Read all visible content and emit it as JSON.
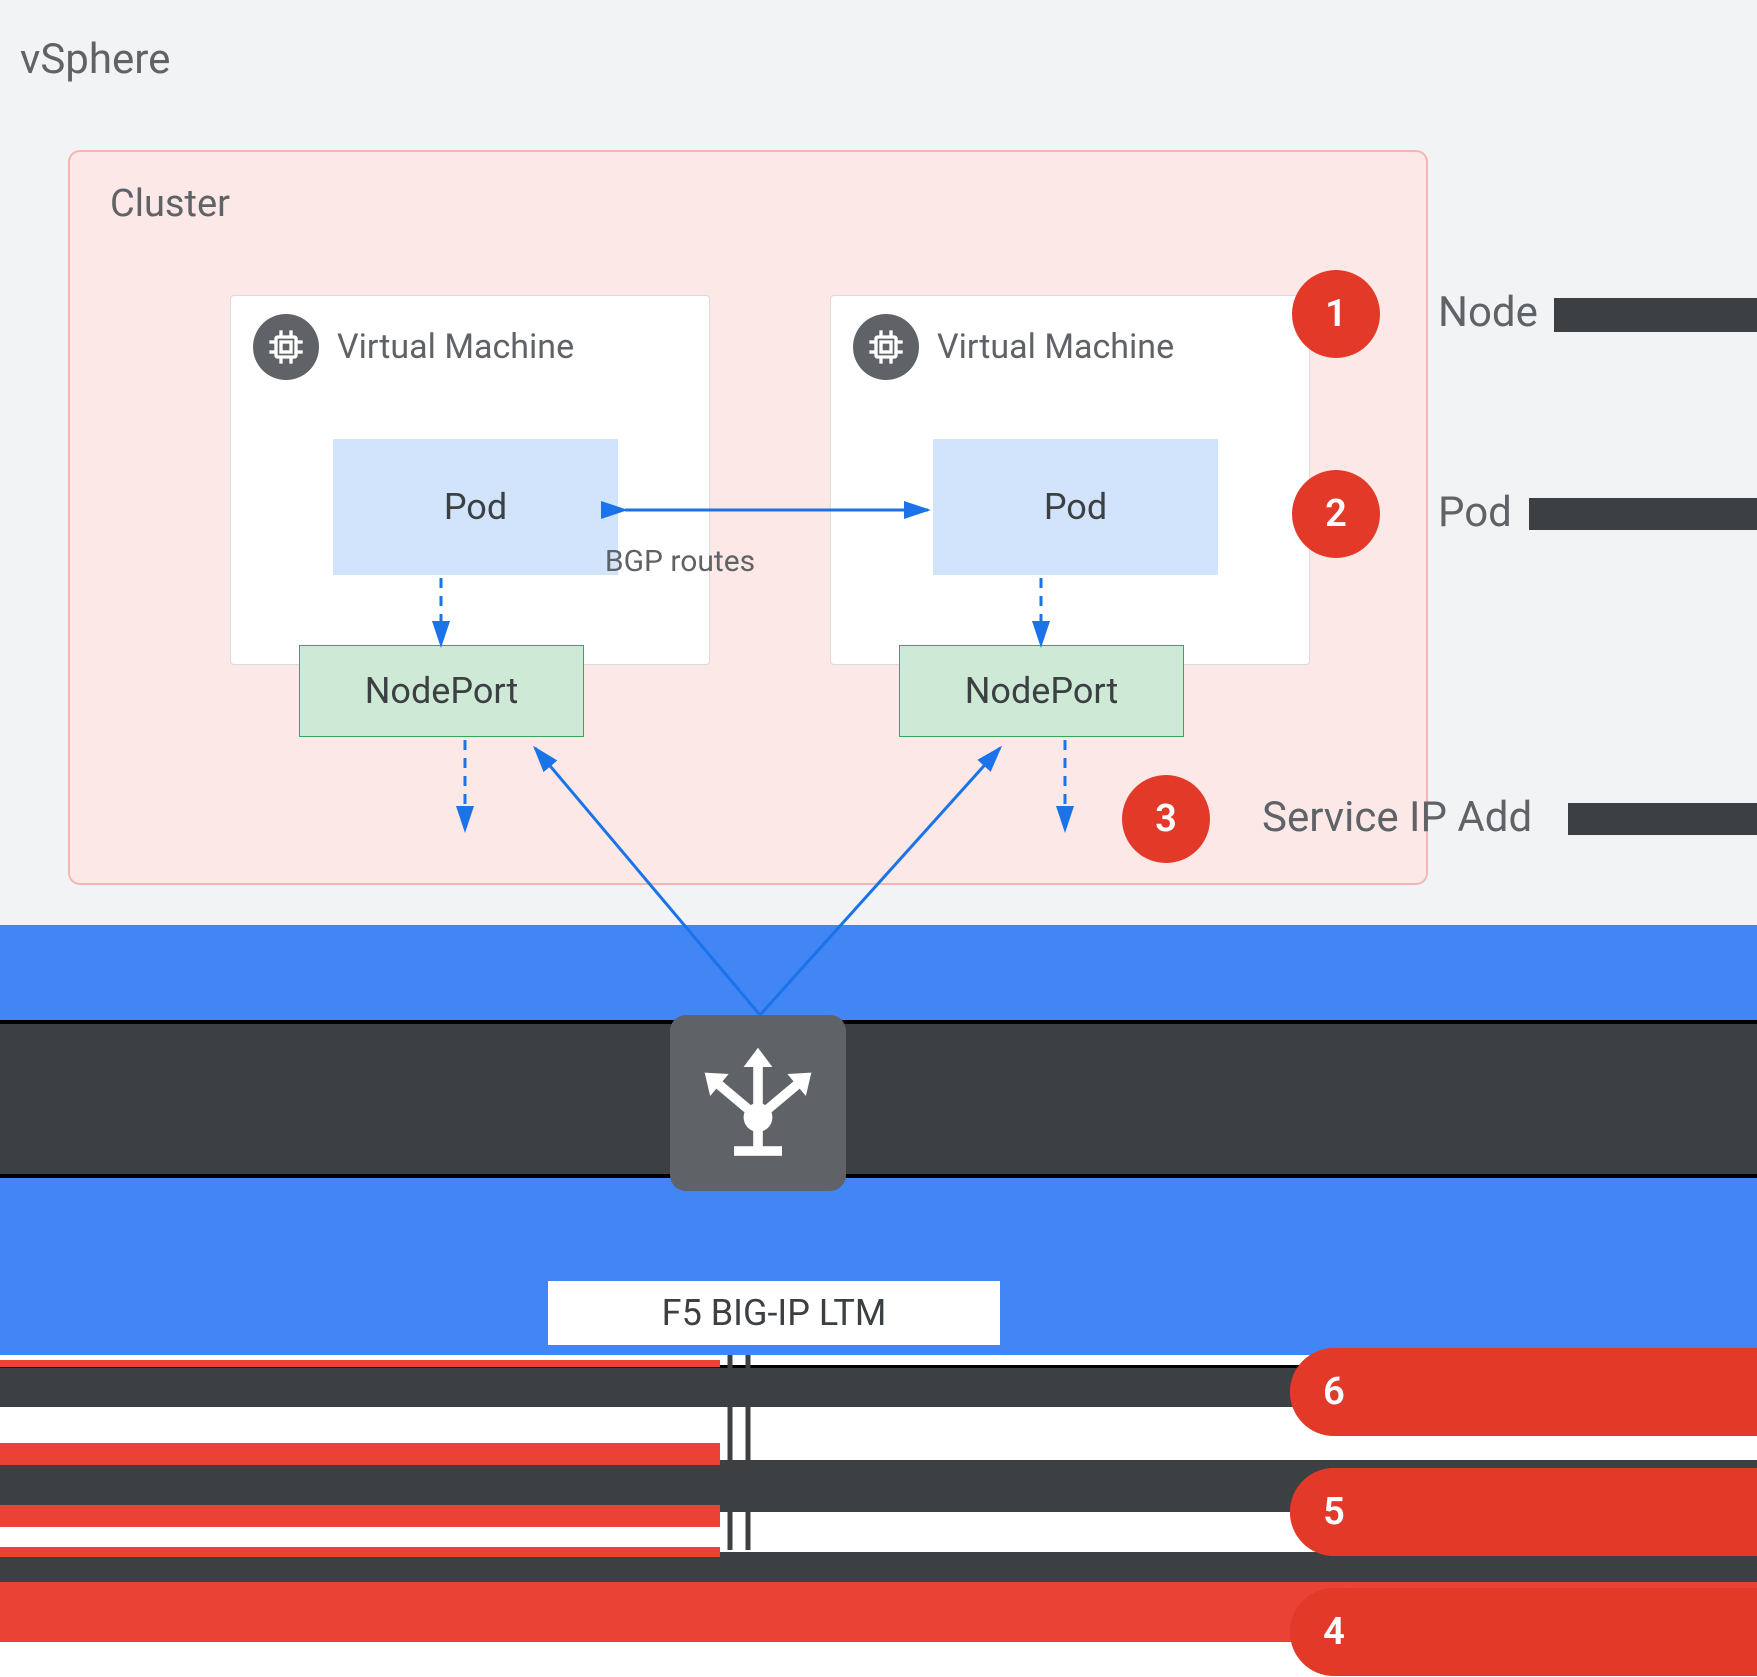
{
  "vsphere": {
    "label": "vSphere"
  },
  "cluster": {
    "label": "Cluster",
    "vms": [
      {
        "label": "Virtual Machine",
        "pod": "Pod",
        "nodeport": "NodePort"
      },
      {
        "label": "Virtual Machine",
        "pod": "Pod",
        "nodeport": "NodePort"
      }
    ],
    "bgp_label": "BGP routes"
  },
  "loadbalancer": {
    "label": "F5 BIG-IP LTM"
  },
  "badges": [
    {
      "num": "1",
      "label": "Node"
    },
    {
      "num": "2",
      "label": "Pod"
    },
    {
      "num": "3",
      "label": "Service IP Add"
    },
    {
      "num": "4",
      "label": ""
    },
    {
      "num": "5",
      "label": ""
    },
    {
      "num": "6",
      "label": ""
    }
  ]
}
